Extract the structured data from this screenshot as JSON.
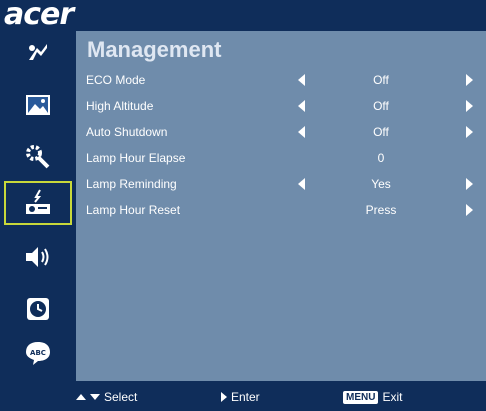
{
  "brand": {
    "logo": "acer"
  },
  "panel": {
    "title": "Management"
  },
  "sidebar": {
    "items": [
      {
        "name": "color",
        "icon": "color-icon"
      },
      {
        "name": "image",
        "icon": "image-icon"
      },
      {
        "name": "setting",
        "icon": "setting-icon"
      },
      {
        "name": "management",
        "icon": "projector-icon",
        "active": true
      },
      {
        "name": "audio",
        "icon": "speaker-icon"
      },
      {
        "name": "timer",
        "icon": "clock-icon"
      },
      {
        "name": "language",
        "icon": "abc-icon"
      }
    ]
  },
  "rows": [
    {
      "label": "ECO Mode",
      "value": "Off",
      "left_arrow": true,
      "right_arrow": true
    },
    {
      "label": "High Altitude",
      "value": "Off",
      "left_arrow": true,
      "right_arrow": true
    },
    {
      "label": "Auto Shutdown",
      "value": "Off",
      "left_arrow": true,
      "right_arrow": true
    },
    {
      "label": "Lamp Hour Elapse",
      "value": "0",
      "left_arrow": false,
      "right_arrow": false
    },
    {
      "label": "Lamp Reminding",
      "value": "Yes",
      "left_arrow": true,
      "right_arrow": true
    },
    {
      "label": "Lamp Hour Reset",
      "value": "Press",
      "left_arrow": false,
      "right_arrow": true
    }
  ],
  "footer": {
    "select_label": "Select",
    "enter_label": "Enter",
    "menu_key": "MENU",
    "exit_label": "Exit"
  },
  "colors": {
    "background": "#0f2d5a",
    "panel": "#6f8cab",
    "active_border": "#c8d83a"
  }
}
